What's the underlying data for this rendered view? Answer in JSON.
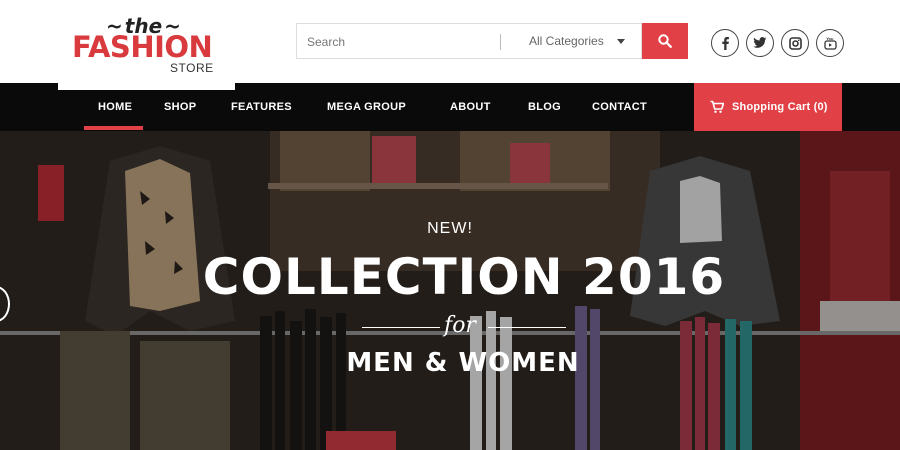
{
  "logo": {
    "the": "the",
    "fashion": "FASHION",
    "store": "STORE"
  },
  "search": {
    "placeholder": "Search",
    "category": "All Categories",
    "button_icon": "search-icon"
  },
  "social": [
    "facebook-icon",
    "twitter-icon",
    "instagram-icon",
    "youtube-icon"
  ],
  "nav": {
    "items": [
      "HOME",
      "SHOP",
      "FEATURES",
      "MEGA GROUP",
      "ABOUT",
      "BLOG",
      "CONTACT"
    ],
    "active": "HOME"
  },
  "cart": {
    "label": "Shopping Cart (0)"
  },
  "hero": {
    "new": "NEW!",
    "title": "COLLECTION 2016",
    "for": "for",
    "subtitle": "MEN & WOMEN"
  },
  "colors": {
    "accent": "#e14146",
    "nav_bg": "#0a0a0a"
  }
}
